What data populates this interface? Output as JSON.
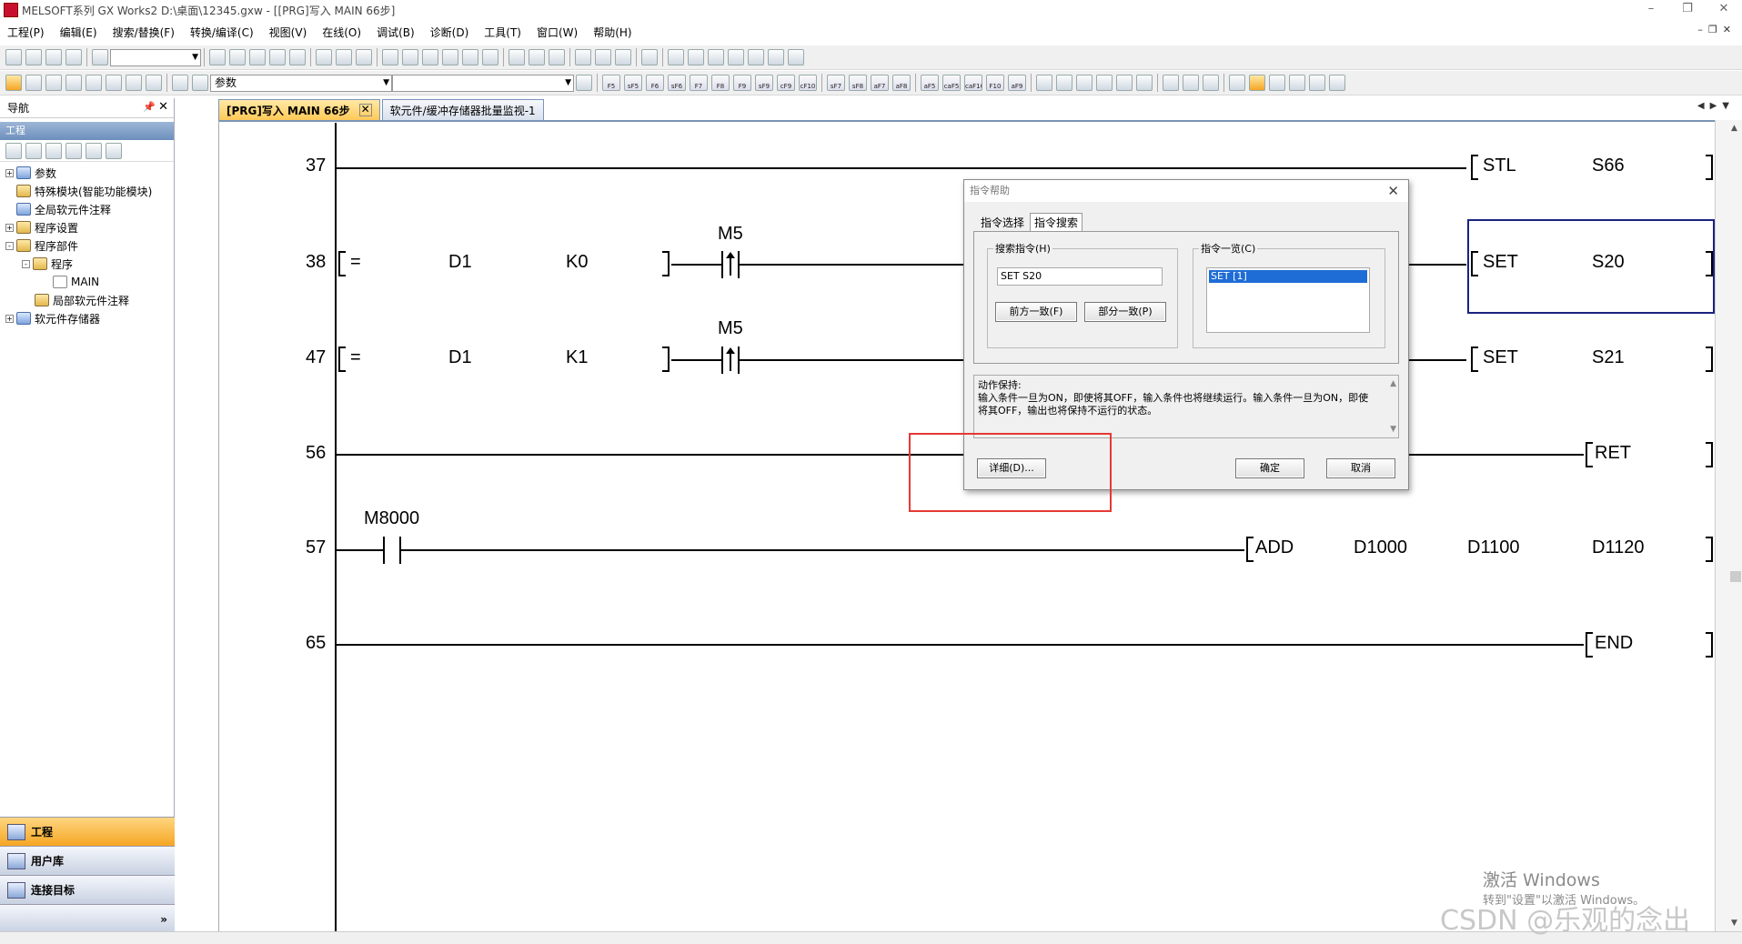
{
  "window": {
    "title": "MELSOFT系列 GX Works2 D:\\桌面\\12345.gxw - [[PRG]写入 MAIN 66步]"
  },
  "menu": [
    "工程(P)",
    "编辑(E)",
    "搜索/替换(F)",
    "转换/编译(C)",
    "视图(V)",
    "在线(O)",
    "调试(B)",
    "诊断(D)",
    "工具(T)",
    "窗口(W)",
    "帮助(H)"
  ],
  "toolbar2": {
    "combo_label": "参数"
  },
  "toolbar2_keys": [
    "F5",
    "sF5",
    "F6",
    "sF6",
    "F7",
    "F8",
    "F9",
    "sF9",
    "cF9",
    "cF10",
    "sF7",
    "sF8",
    "aF7",
    "aF8",
    "aF5",
    "caF5",
    "caF10",
    "F10",
    "aF9"
  ],
  "nav": {
    "header": "导航",
    "project_header": "工程",
    "tree": [
      {
        "label": "参数",
        "indent": 0,
        "exp": "+"
      },
      {
        "label": "特殊模块(智能功能模块)",
        "indent": 0,
        "exp": ""
      },
      {
        "label": "全局软元件注释",
        "indent": 0,
        "exp": ""
      },
      {
        "label": "程序设置",
        "indent": 0,
        "exp": "+"
      },
      {
        "label": "程序部件",
        "indent": 0,
        "exp": "-"
      },
      {
        "label": "程序",
        "indent": 1,
        "exp": "-"
      },
      {
        "label": "MAIN",
        "indent": 2,
        "exp": ""
      },
      {
        "label": "局部软元件注释",
        "indent": 1,
        "exp": ""
      },
      {
        "label": "软元件存储器",
        "indent": 0,
        "exp": "+"
      }
    ],
    "bottom": [
      "工程",
      "用户库",
      "连接目标"
    ]
  },
  "tabs": [
    {
      "label": "[PRG]写入 MAIN 66步",
      "active": true
    },
    {
      "label": "软元件/缓冲存储器批量监视-1",
      "active": false
    }
  ],
  "ladder": {
    "rows": [
      {
        "step": "37",
        "output": [
          "STL",
          "S66"
        ]
      },
      {
        "step": "38",
        "cmp": [
          "=",
          "D1",
          "K0"
        ],
        "contact": "M5",
        "output": [
          "SET",
          "S20"
        ]
      },
      {
        "step": "47",
        "cmp": [
          "=",
          "D1",
          "K1"
        ],
        "contact": "M5",
        "output": [
          "SET",
          "S21"
        ]
      },
      {
        "step": "56",
        "output": [
          "RET"
        ]
      },
      {
        "step": "57",
        "contact": "M8000",
        "output": [
          "ADD",
          "D1000",
          "D1100",
          "D1120"
        ]
      },
      {
        "step": "65",
        "output": [
          "END"
        ]
      }
    ]
  },
  "dialog": {
    "title": "指令帮助",
    "tabs": [
      "指令选择",
      "指令搜索"
    ],
    "search_label": "搜索指令(H)",
    "search_value": "SET S20",
    "btn_prefix": "前方一致(F)",
    "btn_partial": "部分一致(P)",
    "list_label": "指令一览(C)",
    "list_selected": "SET [1]",
    "description": "动作保持:\n输入条件一旦为ON，即使将其OFF，输入条件也将继续运行。输入条件一旦为ON，即使将其OFF，输出也将保持不运行的状态。",
    "btn_detail": "详细(D)...",
    "btn_ok": "确定",
    "btn_cancel": "取消"
  },
  "watermarks": {
    "activate": "激活 Windows",
    "activate_sub": "转到\"设置\"以激活 Windows。",
    "csdn": "CSDN @乐观的念出"
  },
  "colors": {
    "active_tab": "#ffc957",
    "selection": "#1a237e",
    "highlight": "#e53935",
    "list_sel": "#1e6cd6"
  }
}
